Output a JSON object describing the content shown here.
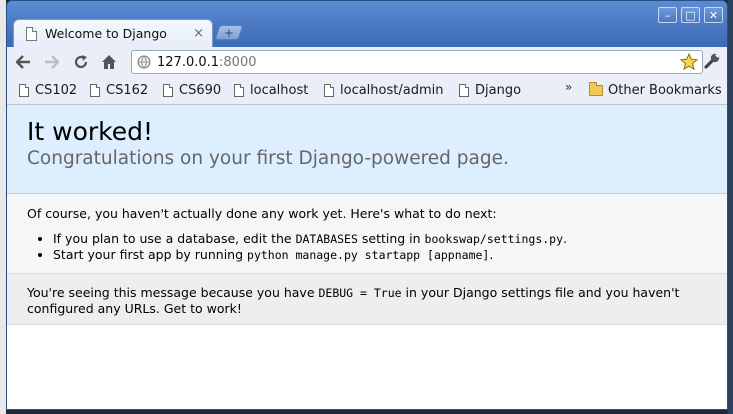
{
  "window": {
    "controls": {
      "minimize": "–",
      "maximize": "□",
      "close": "✕"
    }
  },
  "tab": {
    "title": "Welcome to Django",
    "close": "×"
  },
  "new_tab": {
    "label": "+"
  },
  "toolbar": {
    "url_host": "127.0.0.1",
    "url_port": ":8000",
    "icons": [
      "back-icon",
      "forward-icon",
      "reload-icon",
      "home-icon",
      "globe-icon",
      "star-icon",
      "wrench-icon"
    ]
  },
  "bookmarks": {
    "items": [
      "CS102",
      "CS162",
      "CS690",
      "localhost",
      "localhost/admin",
      "Django"
    ],
    "overflow": "»",
    "other": "Other Bookmarks"
  },
  "page": {
    "summary": {
      "title": "It worked!",
      "subtitle": "Congratulations on your first Django-powered page."
    },
    "instructions": {
      "intro": "Of course, you haven't actually done any work yet. Here's what to do next:",
      "item1_a": "If you plan to use a database, edit the ",
      "item1_code1": "DATABASES",
      "item1_b": " setting in ",
      "item1_code2": "bookswap/settings.py",
      "item1_c": ".",
      "item2_a": "Start your first app by running ",
      "item2_code": "python manage.py startapp [appname]",
      "item2_b": "."
    },
    "explanation": {
      "a": "You're seeing this message because you have ",
      "code": "DEBUG = True",
      "b": " in your Django settings file and you haven't configured any URLs. Get to work!"
    }
  },
  "colors": {
    "titlebar": "#3f6fb8",
    "chrome": "#e9eef8",
    "summary_bg": "#ddeeff",
    "instructions_bg": "#f6f6f6",
    "explanation_bg": "#eeeeee",
    "subtitle": "#666666"
  }
}
